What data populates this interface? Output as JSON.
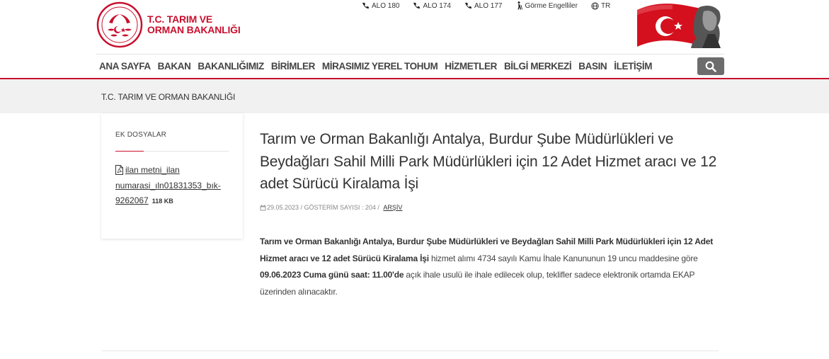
{
  "logo": {
    "line1": "T.C. TARIM VE",
    "line2": "ORMAN BAKANLIĞI"
  },
  "topbar": [
    {
      "icon": "phone-icon",
      "label": "ALO 180"
    },
    {
      "icon": "phone-icon",
      "label": "ALO 174"
    },
    {
      "icon": "phone-icon",
      "label": "ALO 177"
    },
    {
      "icon": "accessibility-icon",
      "label": "Görme Engelliler"
    },
    {
      "icon": "globe-icon",
      "label": "TR"
    }
  ],
  "nav": [
    "ANA SAYFA",
    "BAKAN",
    "BAKANLIĞIMIZ",
    "BİRİMLER",
    "MİRASIMIZ YEREL TOHUM",
    "HİZMETLER",
    "BİLGİ MERKEZİ",
    "BASIN",
    "İLETİŞİM"
  ],
  "breadcrumb": "T.C. TARIM VE ORMAN BAKANLIĞI",
  "sidebar": {
    "title": "EK DOSYALAR",
    "file_name": "ilan metni_ilan numarasi_ıln01831353_bık-9262067",
    "file_size": "118 KB"
  },
  "article": {
    "title": "Tarım ve Orman Bakanlığı Antalya, Burdur Şube Müdürlükleri ve Beydağları Sahil Milli Park Müdürlükleri için 12 Adet Hizmet aracı ve 12 adet Sürücü Kiralama İşi",
    "date": "29.05.2023",
    "views": " / GÖSTERİM SAYISI : 204 / ",
    "category": "ARŞİV",
    "body_bold1": "Tarım ve Orman Bakanlığı Antalya, Burdur Şube Müdürlükleri ve Beydağları Sahil Milli Park Müdürlükleri için 12 Adet Hizmet aracı ve 12 adet Sürücü Kiralama İşi",
    "body_text1": " hizmet alımı 4734 sayılı Kamu İhale Kanununun 19 uncu maddesine göre ",
    "body_bold2": "09.06.2023 Cuma günü saat: 11.00'de",
    "body_text2": " açık ihale usulü ile ihale edilecek olup, teklifler sadece elektronik ortamda EKAP üzerinden alınacaktır."
  },
  "colors": {
    "brand_red": "#c8102e",
    "search_bg": "#6c6c6c",
    "band_bg": "#f1f1f1"
  }
}
